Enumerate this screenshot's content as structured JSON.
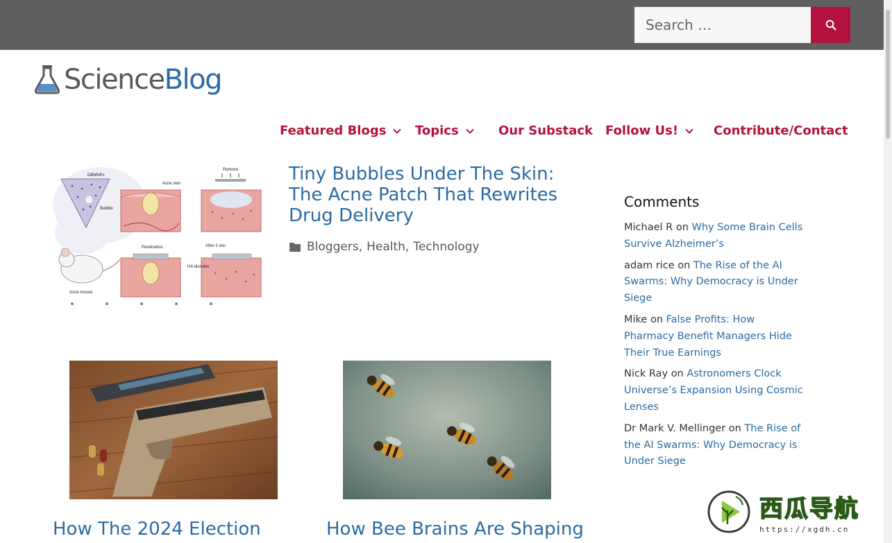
{
  "search": {
    "placeholder": "Search …",
    "button_icon": "search-icon"
  },
  "logo": {
    "science": "Science",
    "blog": "Blog",
    "icon": "flask-icon"
  },
  "nav": {
    "items": [
      {
        "label": "Featured Blogs",
        "has_dropdown": true
      },
      {
        "label": "Topics",
        "has_dropdown": true
      },
      {
        "label": "Our Substack",
        "has_dropdown": false
      },
      {
        "label": "Follow Us!",
        "has_dropdown": true
      },
      {
        "label": "Contribute/Contact",
        "has_dropdown": false
      }
    ]
  },
  "featured_post": {
    "title": "Tiny Bubbles Under The Skin: The Acne Patch That Rewrites Drug Delivery",
    "categories": [
      "Bloggers",
      "Health",
      "Technology"
    ],
    "image_labels": {
      "dbmnps": "DBMNPs",
      "bubble": "Bubble",
      "acne_skin": "Acne skin",
      "remove": "Remove",
      "penetration": "Penetration",
      "after": "After 2 min",
      "ha_dissolve": "HA\ndissolve",
      "acne_mouse": "Acne mouse"
    }
  },
  "posts": [
    {
      "title": "How The 2024 Election",
      "image": "handgun-photo"
    },
    {
      "title": "How Bee Brains Are Shaping",
      "image": "bees-photo"
    }
  ],
  "sidebar": {
    "heading": "Comments",
    "comments": [
      {
        "author": "Michael R",
        "on": "on",
        "post": "Why Some Brain Cells Survive Alzheimer’s"
      },
      {
        "author": "adam rice",
        "on": "on",
        "post": "The Rise of the AI Swarms: Why Democracy is Under Siege"
      },
      {
        "author": "Mike",
        "on": "on",
        "post": "False Profits: How Pharmacy Benefit Managers Hide Their True Earnings"
      },
      {
        "author": "Nick Ray",
        "on": "on",
        "post": "Astronomers Clock Universe’s Expansion Using Cosmic Lenses"
      },
      {
        "author": "Dr Mark V. Mellinger",
        "on": "on",
        "post": "The Rise of the AI Swarms: Why Democracy is Under Siege"
      }
    ]
  },
  "watermark": {
    "name": "西瓜导航",
    "url": "https://xgdh.cn"
  },
  "colors": {
    "accent": "#b3123d",
    "link": "#2b6aa3",
    "topbar": "#5f5f5f"
  }
}
